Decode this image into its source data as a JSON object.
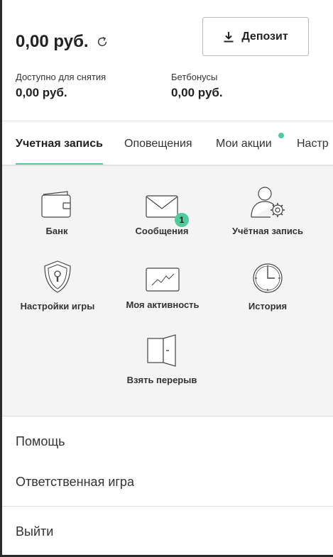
{
  "balance": {
    "amount": "0,00 руб."
  },
  "deposit": {
    "label": "Депозит"
  },
  "withdrawable": {
    "label": "Доступно для снятия",
    "value": "0,00 руб."
  },
  "bet_bonus": {
    "label": "Бетбонусы",
    "value": "0,00 руб."
  },
  "tabs": [
    {
      "label": "Учетная запись",
      "active": true
    },
    {
      "label": "Оповещения"
    },
    {
      "label": "Мои акции",
      "has_dot": true
    },
    {
      "label": "Настр"
    }
  ],
  "account_items": [
    {
      "label": "Банк",
      "icon": "wallet-icon"
    },
    {
      "label": "Сообщения",
      "icon": "envelope-icon",
      "badge": "1"
    },
    {
      "label": "Учётная запись",
      "icon": "user-settings-icon"
    },
    {
      "label": "Настройки игры",
      "icon": "shield-lock-icon"
    },
    {
      "label": "Моя активность",
      "icon": "activity-chart-icon"
    },
    {
      "label": "История",
      "icon": "clock-icon"
    },
    {
      "label": "Взять перерыв",
      "icon": "door-icon"
    }
  ],
  "menu": {
    "help": "Помощь",
    "responsible": "Ответственная игра",
    "logout": "Выйти"
  },
  "colors": {
    "accent": "#4fcb9c",
    "grid_bg": "#f3f4f3",
    "text": "#333333"
  }
}
